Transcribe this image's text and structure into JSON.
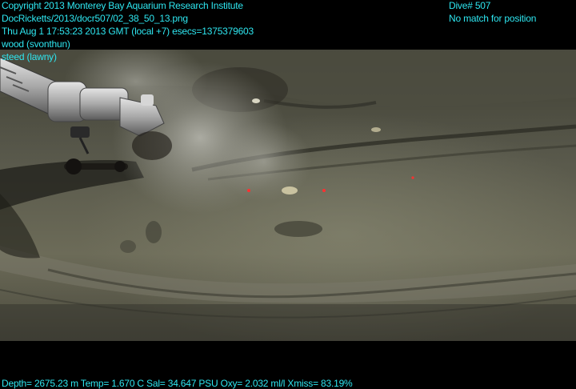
{
  "overlay": {
    "copyright": "Copyright 2013 Monterey Bay Aquarium Research Institute",
    "file_path": "DocRicketts/2013/docr507/02_38_50_13.png",
    "timestamp_line": "Thu Aug  1 17:53:23 2013 GMT (local +7)  esecs=1375379603",
    "observer_1": "wood (svonthun)",
    "observer_2": "steed (lawny)",
    "dive": "Dive# 507",
    "position_status": "No match for position",
    "telemetry": "Depth= 2675.23 m  Temp= 1.670 C  Sal= 34.647 PSU  Oxy= 2.032 ml/l  Xmiss= 83.19%"
  },
  "colors": {
    "overlay_text": "#2ee6f0",
    "letterbox": "#000000",
    "seafloor": "#6d6d58"
  }
}
